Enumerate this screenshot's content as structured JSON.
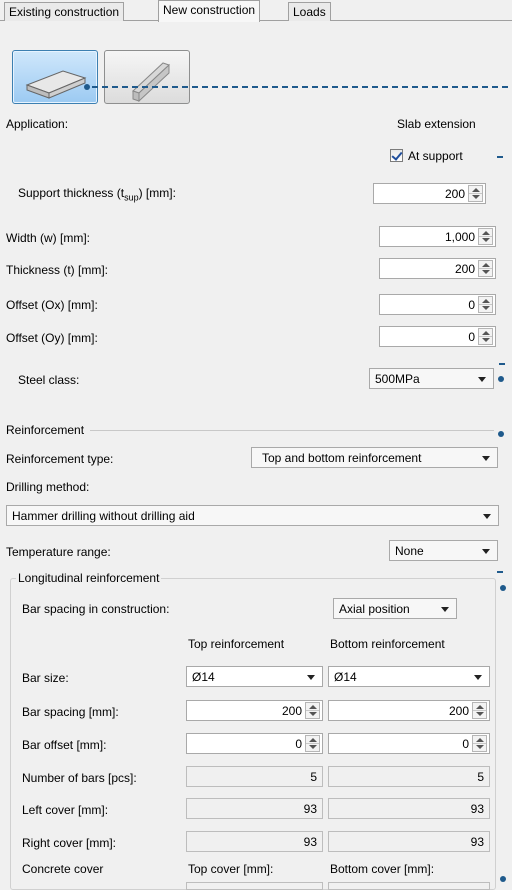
{
  "tabs": [
    "Existing construction",
    "New construction",
    "Loads"
  ],
  "application": {
    "label": "Application:",
    "value": "Slab extension"
  },
  "at_support": {
    "label": "At support",
    "checked": true
  },
  "support_thickness": {
    "label_pre": "Support thickness (t",
    "label_sub": "sup",
    "label_post": ") [mm]:",
    "value": "200"
  },
  "width": {
    "label": "Width (w) [mm]:",
    "value": "1,000"
  },
  "thickness": {
    "label": "Thickness (t) [mm]:",
    "value": "200"
  },
  "offset_x": {
    "label": "Offset (Ox) [mm]:",
    "value": "0"
  },
  "offset_y": {
    "label": "Offset (Oy) [mm]:",
    "value": "0"
  },
  "steel_class": {
    "label": "Steel class:",
    "value": "500MPa"
  },
  "reinforcement": {
    "title": "Reinforcement",
    "type_label": "Reinforcement type:",
    "type_value": "Top and bottom reinforcement",
    "drilling_label": "Drilling method:",
    "drilling_value": "Hammer drilling without drilling aid",
    "temperature_label": "Temperature range:",
    "temperature_value": "None"
  },
  "longitudinal": {
    "title": "Longitudinal reinforcement",
    "bar_spacing_label": "Bar spacing in construction:",
    "bar_spacing_value": "Axial position",
    "col_top": "Top reinforcement",
    "col_bottom": "Bottom reinforcement",
    "bar_size_label": "Bar size:",
    "bar_size_top": "Ø14",
    "bar_size_bottom": "Ø14",
    "bar_spacing_mm_label": "Bar spacing [mm]:",
    "bar_spacing_top": "200",
    "bar_spacing_bottom": "200",
    "bar_offset_label": "Bar offset [mm]:",
    "bar_offset_top": "0",
    "bar_offset_bottom": "0",
    "num_bars_label": "Number of bars [pcs]:",
    "num_bars_top": "5",
    "num_bars_bottom": "5",
    "left_cover_label": "Left cover [mm]:",
    "left_cover_top": "93",
    "left_cover_bottom": "93",
    "right_cover_label": "Right cover [mm]:",
    "right_cover_top": "93",
    "right_cover_bottom": "93",
    "concrete_cover_label": "Concrete cover",
    "top_cover_label": "Top cover [mm]:",
    "bottom_cover_label": "Bottom cover [mm]:"
  },
  "icons": {
    "slab": "slab-icon",
    "beam": "beam-icon"
  },
  "colors": {
    "accent": "#1f5a8c",
    "selected_button": "#9ccaf2"
  }
}
